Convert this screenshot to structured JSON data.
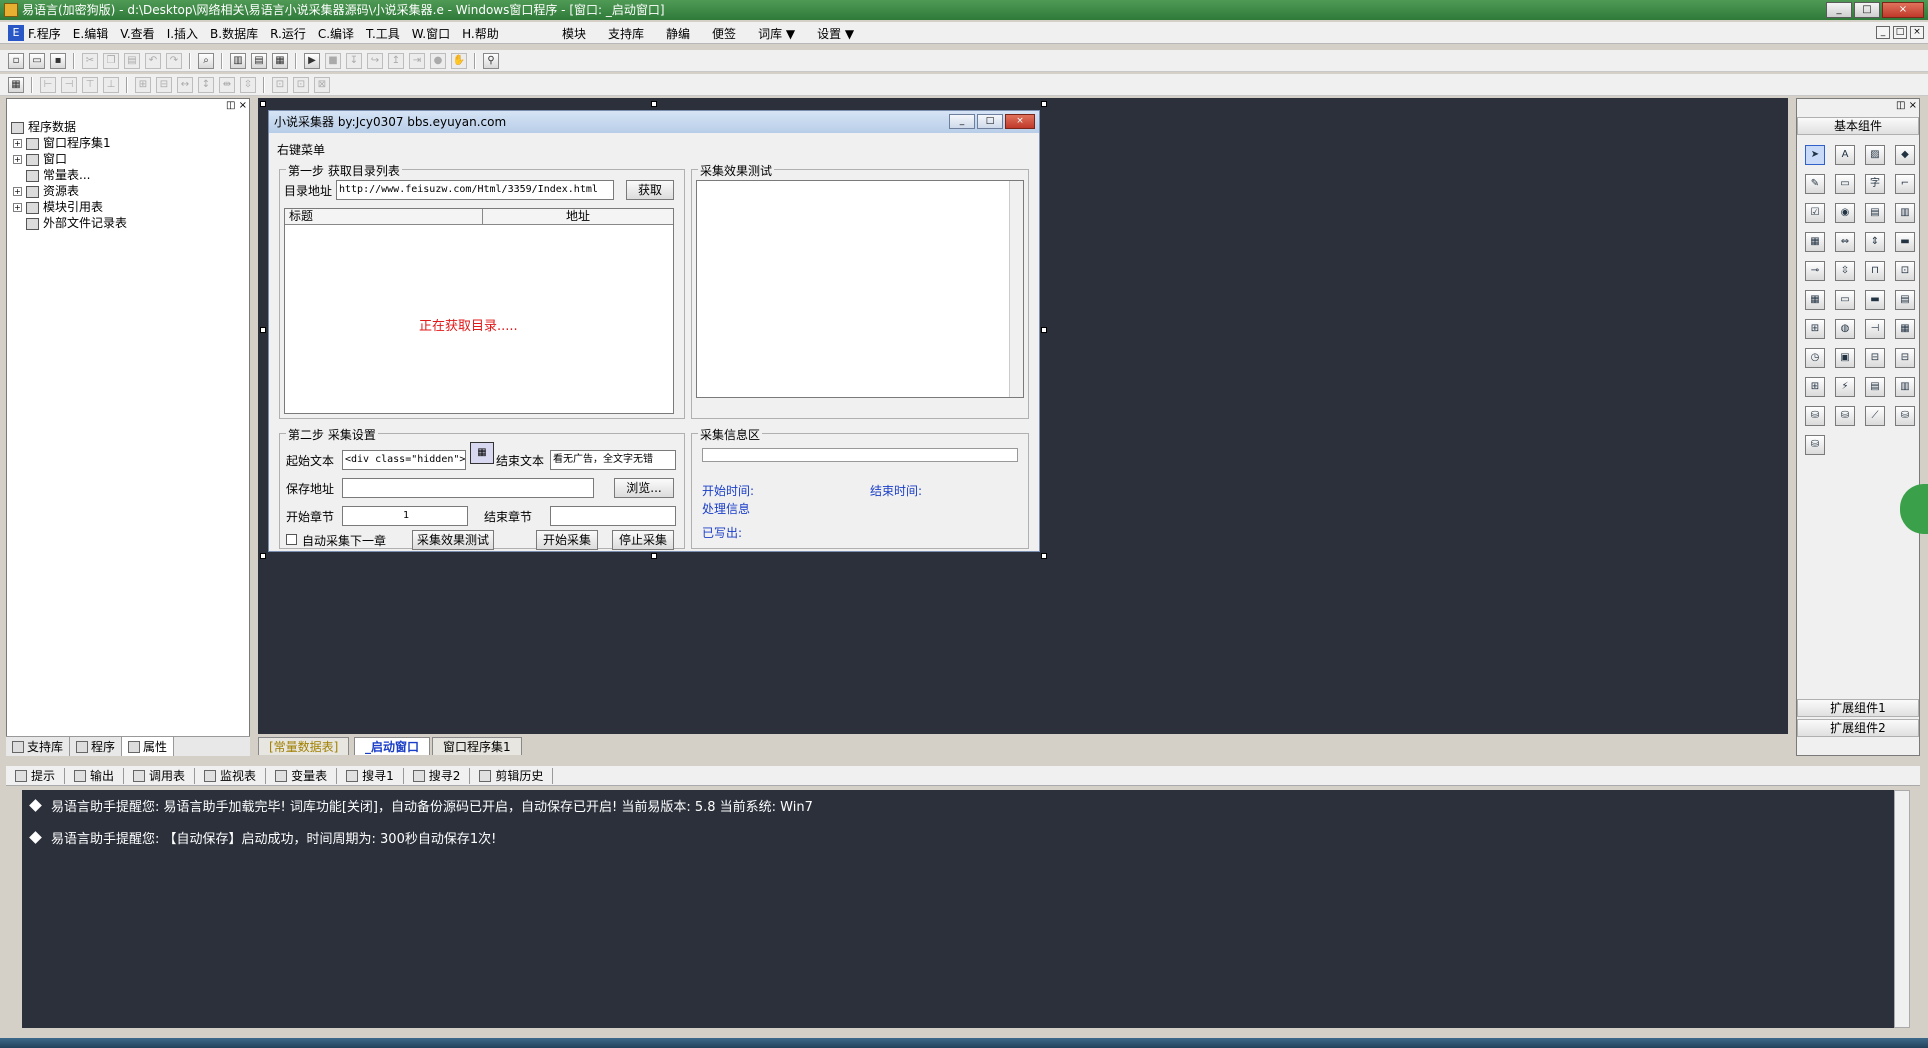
{
  "window": {
    "title": "易语言(加密狗版) - d:\\Desktop\\网络相关\\易语言小说采集器源码\\小说采集器.e - Windows窗口程序 - [窗口: _启动窗口]",
    "minimize": "_",
    "maximize": "□",
    "close": "×"
  },
  "menu": {
    "items": [
      "F.程序",
      "E.编辑",
      "V.查看",
      "I.插入",
      "B.数据库",
      "R.运行",
      "C.编译",
      "T.工具",
      "W.窗口",
      "H.帮助"
    ],
    "extra": [
      "模块",
      "支持库",
      "静编",
      "便签",
      "词库 ▼",
      "设置 ▼"
    ]
  },
  "left_panel": {
    "root": "程序数据",
    "nodes": [
      "窗口程序集1",
      "窗口",
      "常量表...",
      "资源表",
      "模块引用表",
      "外部文件记录表"
    ],
    "tabs": [
      "支持库",
      "程序",
      "属性"
    ]
  },
  "design_tabs": [
    "[常量数据表]",
    "_启动窗口",
    "窗口程序集1"
  ],
  "form": {
    "title": "小说采集器  by:Jcy0307  bbs.eyuyan.com",
    "menu_label": "右键菜单",
    "step1": {
      "title": "第一步 获取目录列表",
      "url_label": "目录地址",
      "url_value": "http://www.feisuzw.com/Html/3359/Index.html",
      "fetch_button": "获取",
      "columns": [
        "标题",
        "地址"
      ],
      "status": "正在获取目录....."
    },
    "preview": {
      "title": "采集效果测试"
    },
    "step2": {
      "title": "第二步 采集设置",
      "start_text_label": "起始文本",
      "start_text_value": "<div class=\"hidden\">",
      "end_text_label": "结束文本",
      "end_text_value": "看无广告，全文字无错",
      "save_label": "保存地址",
      "browse_button": "浏览...",
      "start_chapter_label": "开始章节",
      "start_chapter_value": "1",
      "end_chapter_label": "结束章节",
      "auto_next_label": "自动采集下一章",
      "test_button": "采集效果测试",
      "start_button": "开始采集",
      "stop_button": "停止采集"
    },
    "info": {
      "title": "采集信息区",
      "start_time": "开始时间:",
      "end_time": "结束时间:",
      "process": "处理信息",
      "written": "已写出:"
    }
  },
  "right_panel": {
    "basic": "基本组件",
    "ext1": "扩展组件1",
    "ext2": "扩展组件2"
  },
  "bottom_tabs": [
    "提示",
    "输出",
    "调用表",
    "监视表",
    "变量表",
    "搜寻1",
    "搜寻2",
    "剪辑历史"
  ],
  "output": [
    "易语言助手提醒您:  易语言助手加载完毕!  词库功能[关闭]，自动备份源码已开启，自动保存已开启!  当前易版本: 5.8  当前系统: Win7",
    "易语言助手提醒您: 【自动保存】启动成功，时间周期为: 300秒自动保存1次!"
  ],
  "colors": {
    "design_bg": "#2b303b",
    "title_green": "#2f7a39",
    "status_red": "#e01818",
    "info_blue": "#1a3ec8"
  }
}
